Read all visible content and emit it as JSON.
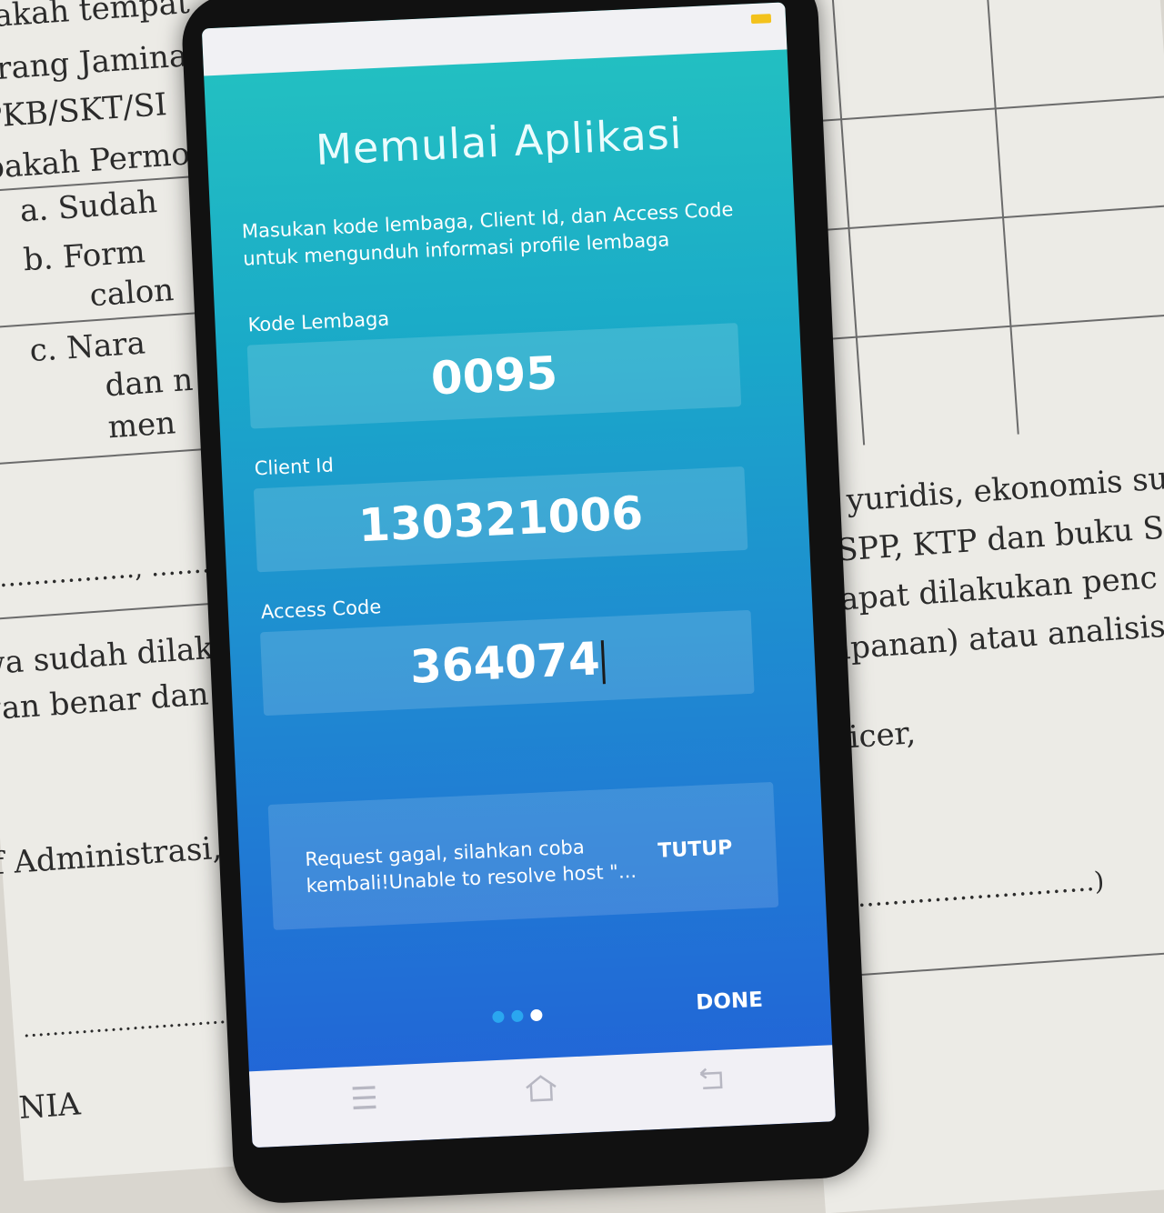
{
  "background_paper": {
    "left_lines": [
      "Apakah tempat",
      "Barang Jamina",
      "BPKB/SKT/SI",
      "Apakah Permo",
      "a.   Sudah",
      "b.   Form",
      "calon",
      "c.   Nara",
      "dan n",
      "men",
      "………………, ………",
      "wa sudah dilaku",
      "gan benar dan p",
      "f  Administrasi,",
      "……………………………",
      "NIA"
    ],
    "right_lines": [
      "ara yuridis, ekonomis su",
      "an SPP, KTP dan buku S",
      "a dapat dilakukan penc",
      "simpanan) atau analisis",
      "Officer,",
      "…………………………)"
    ]
  },
  "app": {
    "title": "Memulai Aplikasi",
    "subtitle": "Masukan kode lembaga, Client Id, dan Access Code untuk mengunduh informasi profile lembaga",
    "fields": {
      "kode_lembaga": {
        "label": "Kode Lembaga",
        "value": "0095"
      },
      "client_id": {
        "label": "Client Id",
        "value": "130321006"
      },
      "access_code": {
        "label": "Access Code",
        "value": "364074"
      }
    },
    "toast": {
      "message": "Request gagal, silahkan coba kembali!Unable to resolve host \"...",
      "action_label": "TUTUP"
    },
    "pager": {
      "total": 3,
      "active_index": 2
    },
    "done_label": "DONE"
  },
  "colors": {
    "gradient_top": "#24c3c0",
    "gradient_bottom": "#2260d8",
    "battery": "#f3c21c",
    "dot_inactive": "#2aa7f0",
    "dot_active": "#ffffff"
  },
  "icons": {
    "nav_menu": "menu-icon",
    "nav_home": "home-icon",
    "nav_back": "back-icon"
  }
}
